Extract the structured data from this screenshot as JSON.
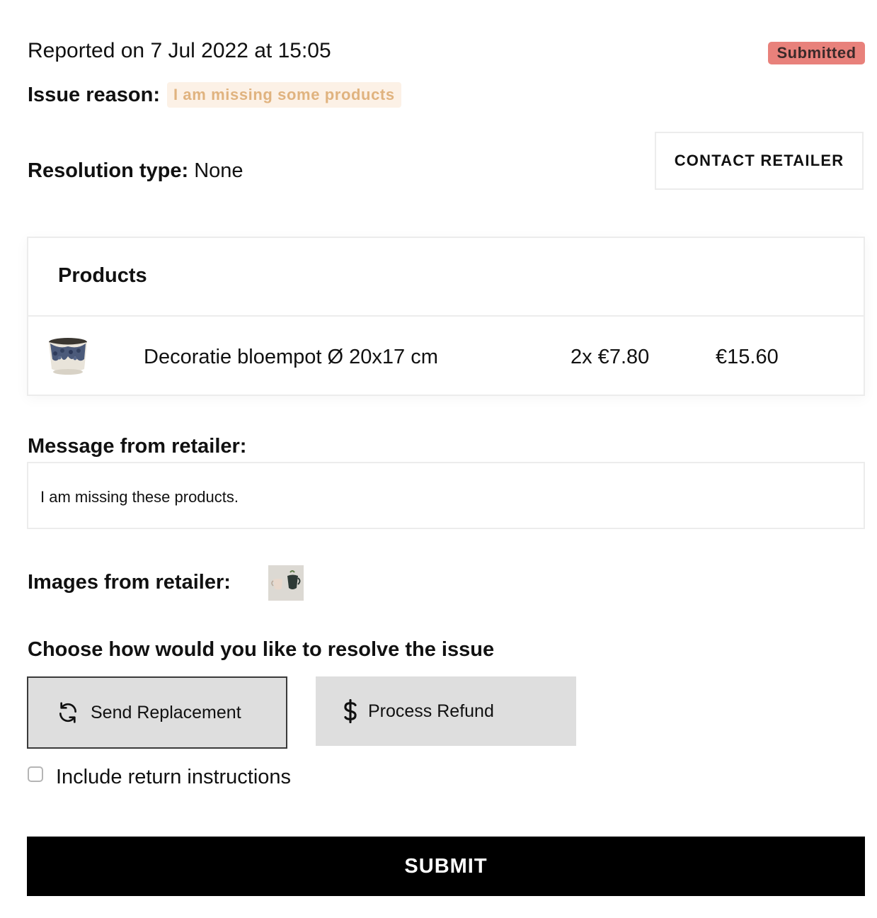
{
  "header": {
    "reported_text": "Reported on 7 Jul 2022 at 15:05",
    "status_badge": "Submitted",
    "status_color": "#e8817b"
  },
  "issue": {
    "label": "Issue reason:",
    "reason": "I am missing some products"
  },
  "resolution": {
    "label": "Resolution type:",
    "value": "None"
  },
  "contact_button": "CONTACT RETAILER",
  "products": {
    "title": "Products",
    "items": [
      {
        "name": "Decoratie bloempot Ø 20x17 cm",
        "qty_price": "2x €7.80",
        "total": "€15.60",
        "image_icon": "flower-pot-image"
      }
    ]
  },
  "message": {
    "label": "Message from retailer:",
    "text": "I am missing these products."
  },
  "images": {
    "label": "Images from retailer:",
    "thumb_icon": "mugs-photo"
  },
  "resolve": {
    "title": "Choose how would you like to resolve the issue",
    "options": [
      {
        "label": "Send Replacement",
        "icon": "refresh-icon",
        "selected": true
      },
      {
        "label": "Process Refund",
        "icon": "dollar-icon",
        "selected": false
      }
    ],
    "checkbox_label": "Include return instructions",
    "checkbox_checked": false
  },
  "submit_label": "SUBMIT",
  "colors": {
    "accent_black": "#000000",
    "chip_bg": "#fcf1e6",
    "chip_text": "#e0b37f",
    "option_bg": "#dedede"
  }
}
